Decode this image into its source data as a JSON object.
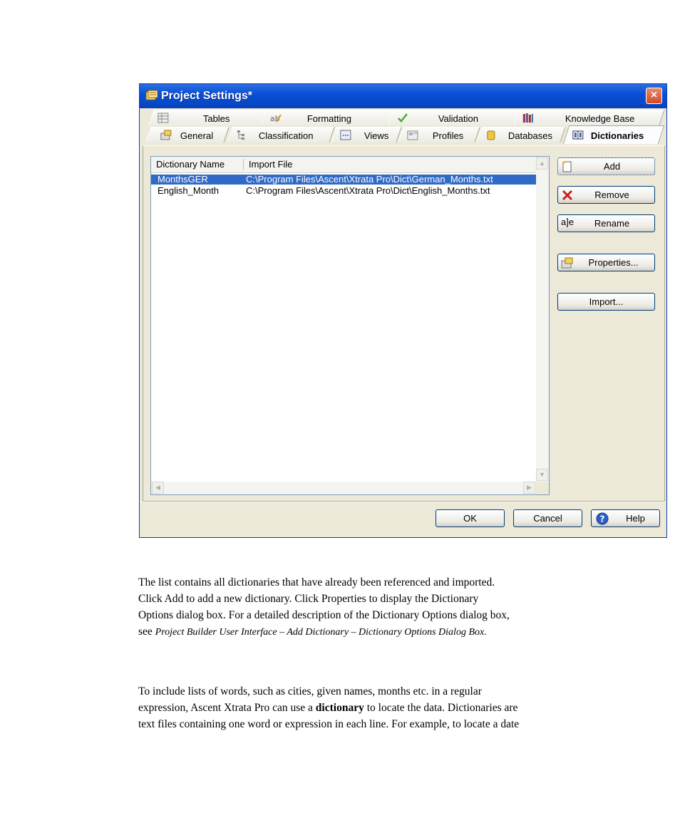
{
  "window": {
    "title": "Project Settings*",
    "close_label": "×"
  },
  "tabs_row1": [
    {
      "label": "Tables",
      "icon": "table-icon"
    },
    {
      "label": "Formatting",
      "icon": "formatting-icon"
    },
    {
      "label": "Validation",
      "icon": "checkmark-icon"
    },
    {
      "label": "Knowledge Base",
      "icon": "books-icon"
    }
  ],
  "tabs_row2": [
    {
      "label": "General",
      "icon": "general-icon"
    },
    {
      "label": "Classification",
      "icon": "classification-icon"
    },
    {
      "label": "Views",
      "icon": "views-icon"
    },
    {
      "label": "Profiles",
      "icon": "profiles-icon"
    },
    {
      "label": "Databases",
      "icon": "database-icon"
    },
    {
      "label": "Dictionaries",
      "icon": "dictionary-icon",
      "active": true
    }
  ],
  "list": {
    "columns": [
      "Dictionary Name",
      "Import File"
    ],
    "rows": [
      {
        "name": "MonthsGER",
        "file": "C:\\Program Files\\Ascent\\Xtrata Pro\\Dict\\German_Months.txt",
        "selected": true
      },
      {
        "name": "English_Month",
        "file": "C:\\Program Files\\Ascent\\Xtrata Pro\\Dict\\English_Months.txt",
        "selected": false
      }
    ]
  },
  "side_buttons": {
    "add": "Add",
    "remove": "Remove",
    "rename": "Rename",
    "rename_icon_text": "a]e",
    "properties": "Properties...",
    "import": "Import..."
  },
  "footer": {
    "ok": "OK",
    "cancel": "Cancel",
    "help": "Help"
  },
  "doc": {
    "para1_line1": "The list contains all dictionaries that have already been referenced and imported.",
    "para1_line2": "Click Add to add a new dictionary. Click Properties to display the Dictionary",
    "para1_line3": "Options dialog box.  For a detailed description of the Dictionary Options dialog box,",
    "para1_line4_prefix": "see ",
    "para1_line4_ref": "Project Builder User Interface – Add Dictionary – Dictionary Options Dialog Box.",
    "para2_line1": "To include lists of words, such   as cities, given names, months etc. in a regular",
    "para2_line2_a": "expression, Ascent Xtrata Pro can use a ",
    "para2_line2_bold": "dictionary",
    "para2_line2_b": " to locate the data. Dictionaries are",
    "para2_line3": "text files containing one word or expression in each line. For example, to locate a date"
  },
  "colors": {
    "titlebar": "#0a4fd8",
    "selection": "#316ac5",
    "dialog_bg": "#ece9d8"
  }
}
